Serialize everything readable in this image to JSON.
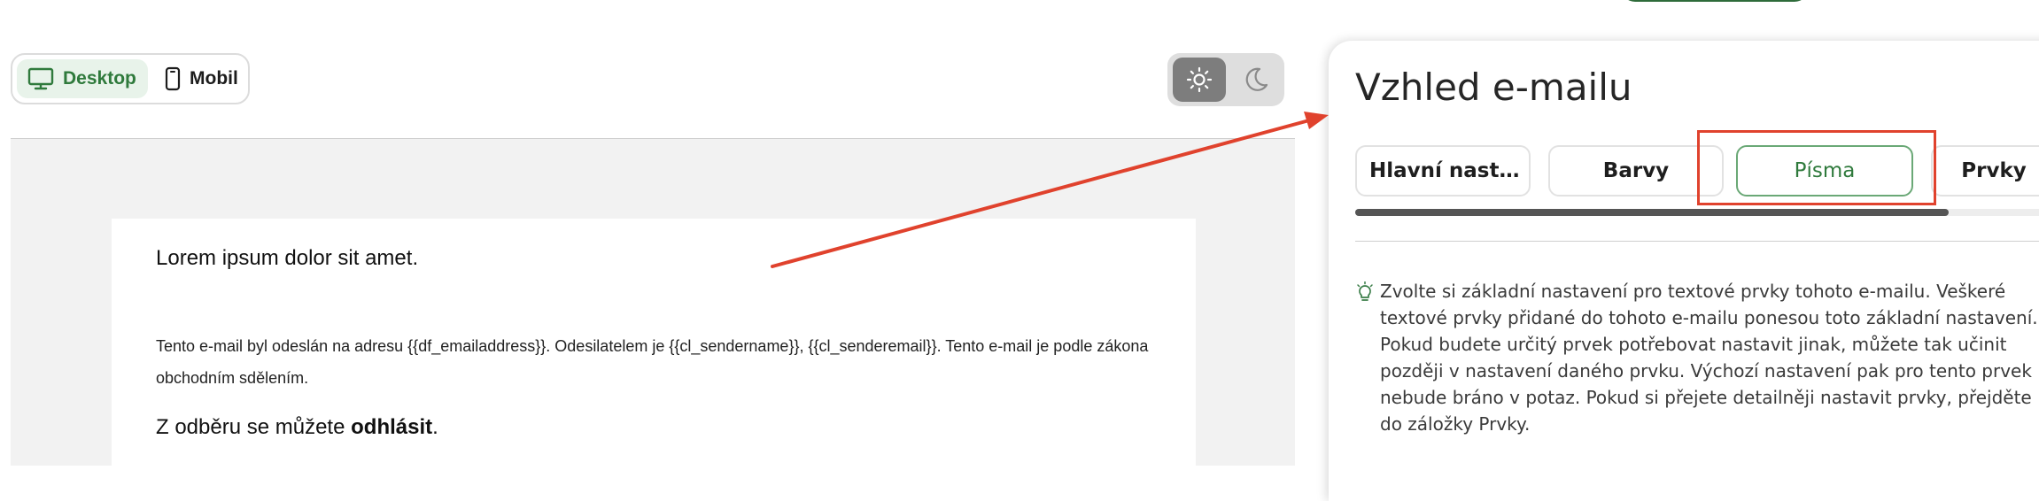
{
  "device_toggle": {
    "desktop_label": "Desktop",
    "mobile_label": "Mobil",
    "selected": "Desktop",
    "desktop_icon": "monitor-icon",
    "mobile_icon": "smartphone-icon"
  },
  "theme_toggle": {
    "light_icon": "sun-icon",
    "dark_icon": "moon-icon",
    "selected": "light"
  },
  "email_preview": {
    "title": "Lorem ipsum dolor sit amet.",
    "footer_text": "Tento e-mail byl odeslán na adresu {{df_emailaddress}}. Odesilatelem je {{cl_sendername}}, {{cl_senderemail}}. Tento e-mail je podle zákona obchodním sdělením.",
    "unsubscribe_prefix": "Z odběru se můžete ",
    "unsubscribe_link": "odhlásit",
    "unsubscribe_suffix": "."
  },
  "panel": {
    "title": "Vzhled e-mailu",
    "tabs": [
      {
        "label": "Hlavní nastavení"
      },
      {
        "label": "Barvy"
      },
      {
        "label": "Písma"
      },
      {
        "label": "Prvky"
      }
    ],
    "active_tab": "Písma",
    "hint_icon": "lightbulb-icon",
    "hint_text": "Zvolte si základní nastavení pro textové prvky tohoto e-mailu. Veškeré textové prvky přidané do tohoto e-mailu ponesou toto základní nastavení. Pokud budete určitý prvek potřebovat nastavit jinak, můžete tak učinit později v nastavení daného prvku. Výchozí nastavení pak pro tento prvek nebude bráno v potaz. Pokud si přejete detailněji nastavit prvky, přejděte do záložky Prvky."
  },
  "colors": {
    "accent_green": "#2f7a3c",
    "annotation_red": "#e0422d"
  }
}
